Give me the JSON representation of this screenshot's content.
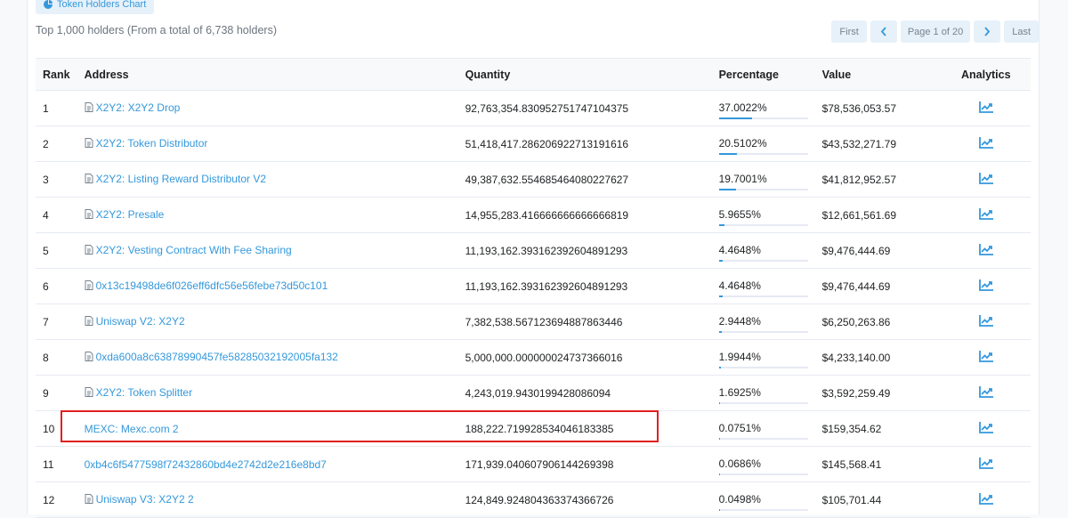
{
  "header": {
    "chart_button_label": "Token Holders Chart",
    "summary": "Top 1,000 holders (From a total of 6,738 holders)"
  },
  "pager": {
    "first": "First",
    "page_label": "Page 1 of 20",
    "last": "Last"
  },
  "table": {
    "columns": [
      "Rank",
      "Address",
      "Quantity",
      "Percentage",
      "Value",
      "Analytics"
    ],
    "rows": [
      {
        "rank": "1",
        "address": "X2Y2: X2Y2 Drop",
        "contract": true,
        "quantity": "92,763,354.830952751747104375",
        "percentage": "37.0022%",
        "pct_value": 37.0022,
        "value": "$78,536,053.57"
      },
      {
        "rank": "2",
        "address": "X2Y2: Token Distributor",
        "contract": true,
        "quantity": "51,418,417.286206922713191616",
        "percentage": "20.5102%",
        "pct_value": 20.5102,
        "value": "$43,532,271.79"
      },
      {
        "rank": "3",
        "address": "X2Y2: Listing Reward Distributor V2",
        "contract": true,
        "quantity": "49,387,632.554685464080227627",
        "percentage": "19.7001%",
        "pct_value": 19.7001,
        "value": "$41,812,952.57"
      },
      {
        "rank": "4",
        "address": "X2Y2: Presale",
        "contract": true,
        "quantity": "14,955,283.416666666666666819",
        "percentage": "5.9655%",
        "pct_value": 5.9655,
        "value": "$12,661,561.69"
      },
      {
        "rank": "5",
        "address": "X2Y2: Vesting Contract With Fee Sharing",
        "contract": true,
        "quantity": "11,193,162.393162392604891293",
        "percentage": "4.4648%",
        "pct_value": 4.4648,
        "value": "$9,476,444.69"
      },
      {
        "rank": "6",
        "address": "0x13c19498de6f026eff6dfc56e56febe73d50c101",
        "contract": true,
        "quantity": "11,193,162.393162392604891293",
        "percentage": "4.4648%",
        "pct_value": 4.4648,
        "value": "$9,476,444.69"
      },
      {
        "rank": "7",
        "address": "Uniswap V2: X2Y2",
        "contract": true,
        "quantity": "7,382,538.567123694887863446",
        "percentage": "2.9448%",
        "pct_value": 2.9448,
        "value": "$6,250,263.86"
      },
      {
        "rank": "8",
        "address": "0xda600a8c63878990457fe58285032192005fa132",
        "contract": true,
        "quantity": "5,000,000.000000024737366016",
        "percentage": "1.9944%",
        "pct_value": 1.9944,
        "value": "$4,233,140.00"
      },
      {
        "rank": "9",
        "address": "X2Y2: Token Splitter",
        "contract": true,
        "quantity": "4,243,019.9430199428086094",
        "percentage": "1.6925%",
        "pct_value": 1.6925,
        "value": "$3,592,259.49"
      },
      {
        "rank": "10",
        "address": "MEXC: Mexc.com 2",
        "contract": false,
        "quantity": "188,222.719928534046183385",
        "percentage": "0.0751%",
        "pct_value": 0.0751,
        "value": "$159,354.62"
      },
      {
        "rank": "11",
        "address": "0xb4c6f5477598f72432860bd4e2742d2e216e8bd7",
        "contract": false,
        "quantity": "171,939.040607906144269398",
        "percentage": "0.0686%",
        "pct_value": 0.0686,
        "value": "$145,568.41"
      },
      {
        "rank": "12",
        "address": "Uniswap V3: X2Y2 2",
        "contract": true,
        "quantity": "124,849.924804363374366726",
        "percentage": "0.0498%",
        "pct_value": 0.0498,
        "value": "$105,701.44"
      }
    ]
  },
  "icons": {
    "chart_button": "pie-chart-icon",
    "contract": "file-document-icon",
    "analytics": "line-chart-icon",
    "prev": "chevron-left-icon",
    "next": "chevron-right-icon"
  },
  "colors": {
    "link": "#3498db",
    "highlight_box": "#e02020",
    "button_bg": "#e7f1fa"
  }
}
